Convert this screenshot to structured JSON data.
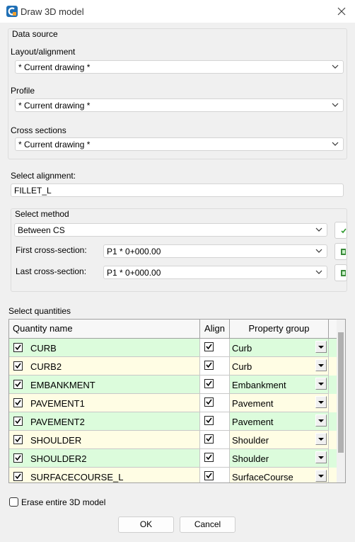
{
  "window": {
    "title": "Draw 3D model",
    "icon": "app-logo-icon",
    "close_icon": "close-icon"
  },
  "data_source": {
    "heading": "Data source",
    "layout_label": "Layout/alignment",
    "layout_value": "* Current drawing *",
    "profile_label": "Profile",
    "profile_value": "* Current drawing *",
    "cross_label": "Cross sections",
    "cross_value": "* Current drawing *"
  },
  "alignment": {
    "label": "Select alignment:",
    "value": "FILLET_L"
  },
  "method": {
    "heading": "Select method",
    "method_value": "Between CS",
    "first_label": "First cross-section:",
    "first_value": "P1 * 0+000.00",
    "last_label": "Last cross-section:",
    "last_value": "P1 * 0+000.00"
  },
  "quantities": {
    "heading": "Select quantities",
    "columns": [
      "Quantity name",
      "Align",
      "Property group"
    ],
    "rows": [
      {
        "name": "CURB",
        "checked": true,
        "align": true,
        "group": "Curb",
        "color": "#dcfcdc"
      },
      {
        "name": "CURB2",
        "checked": true,
        "align": true,
        "group": "Curb",
        "color": "#fffde4"
      },
      {
        "name": "EMBANKMENT",
        "checked": true,
        "align": true,
        "group": "Embankment",
        "color": "#dcfcdc"
      },
      {
        "name": "PAVEMENT1",
        "checked": true,
        "align": true,
        "group": "Pavement",
        "color": "#fffde4"
      },
      {
        "name": "PAVEMENT2",
        "checked": true,
        "align": true,
        "group": "Pavement",
        "color": "#dcfcdc"
      },
      {
        "name": "SHOULDER",
        "checked": true,
        "align": true,
        "group": "Shoulder",
        "color": "#fffde4"
      },
      {
        "name": "SHOULDER2",
        "checked": true,
        "align": true,
        "group": "Shoulder",
        "color": "#dcfcdc"
      },
      {
        "name": "SURFACECOURSE_L",
        "checked": true,
        "align": true,
        "group": "SurfaceCourse",
        "color": "#fffde4"
      }
    ]
  },
  "erase": {
    "label": "Erase entire 3D model",
    "checked": false
  },
  "buttons": {
    "ok": "OK",
    "cancel": "Cancel"
  }
}
